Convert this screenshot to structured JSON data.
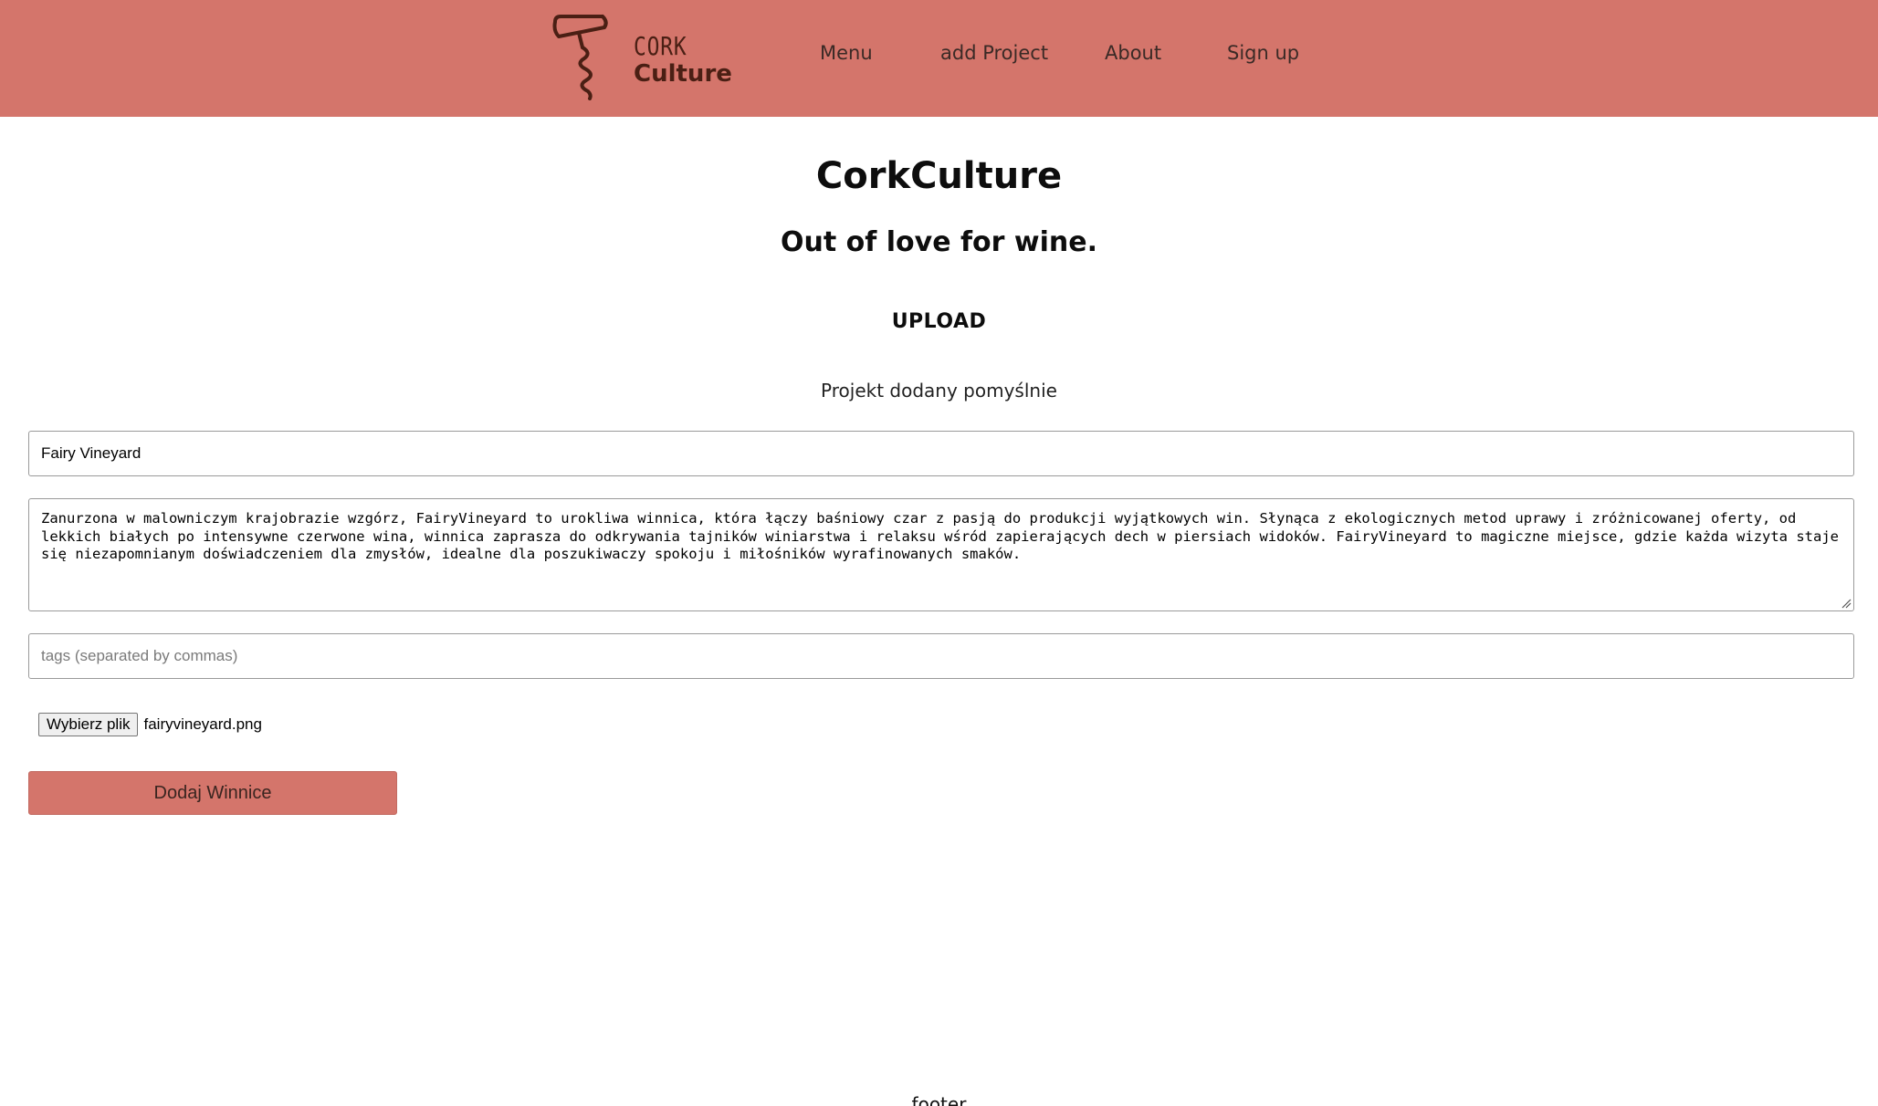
{
  "header": {
    "logo": {
      "line1": "CORK",
      "line2": "Culture"
    },
    "nav": [
      "Menu",
      "add Project",
      "About",
      "Sign up"
    ]
  },
  "main": {
    "title": "CorkCulture",
    "subtitle": "Out of love for wine.",
    "section_heading": "UPLOAD",
    "status_message": "Projekt dodany pomyślnie"
  },
  "form": {
    "name_value": "Fairy Vineyard",
    "description_value": "Zanurzona w malowniczym krajobrazie wzgórz, FairyVineyard to urokliwa winnica, która łączy baśniowy czar z pasją do produkcji wyjątkowych win. Słynąca z ekologicznych metod uprawy i zróżnicowanej oferty, od lekkich białych po intensywne czerwone wina, winnica zaprasza do odkrywania tajników winiarstwa i relaksu wśród zapierających dech w piersiach widoków. FairyVineyard to magiczne miejsce, gdzie każda wizyta staje się niezapomnianym doświadczeniem dla zmysłów, idealne dla poszukiwaczy spokoju i miłośników wyrafinowanych smaków.",
    "tags_placeholder": "tags (separated by commas)",
    "file_button_label": "Wybierz plik",
    "file_name": "fairyvineyard.png",
    "submit_label": "Dodaj Winnice"
  },
  "footer": {
    "text": "footer"
  },
  "colors": {
    "accent": "#d4756b",
    "logo": "#4a1f14"
  },
  "icons": {
    "logo": "corkscrew-icon",
    "resize": "resize-grip-icon"
  }
}
